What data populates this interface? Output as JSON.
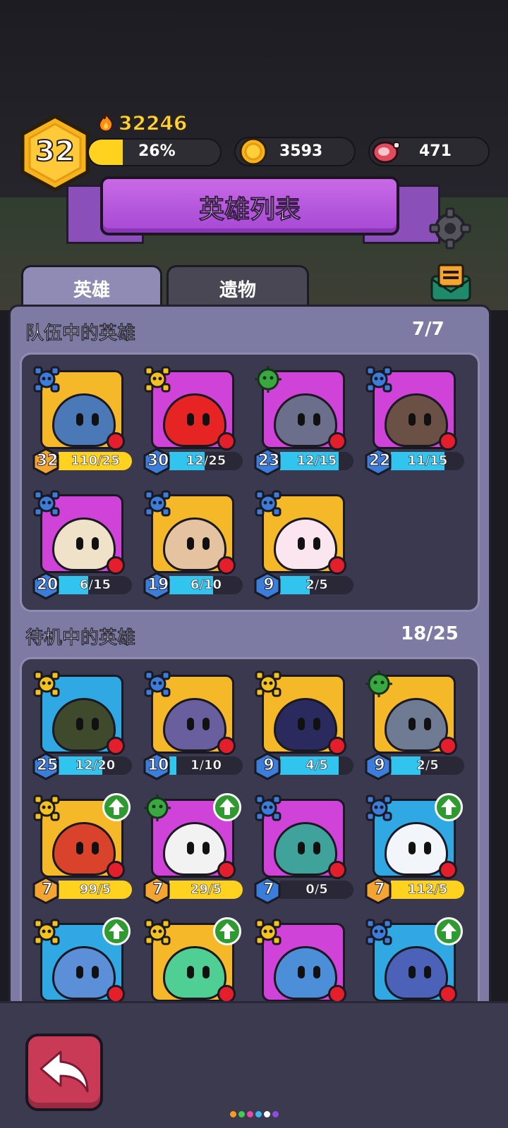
{
  "header": {
    "player_level": "32",
    "power": "32246",
    "xp_percent_label": "26%",
    "xp_fraction": 0.26,
    "gold": "3593",
    "meat": "471"
  },
  "title": "英雄列表",
  "tabs": [
    {
      "label": "英雄",
      "active": true
    },
    {
      "label": "遗物",
      "active": false
    }
  ],
  "team": {
    "title": "队伍中的英雄",
    "count": "7/7",
    "heroes": [
      {
        "level": "32",
        "progress": "110/25",
        "fill": 1.0,
        "bar_color": "#ffd21f",
        "class": "blue",
        "portrait_bg": "#f5b828",
        "body": "#4b79b8",
        "upgrade": false
      },
      {
        "level": "30",
        "progress": "12/25",
        "fill": 0.48,
        "bar_color": "#31c4ef",
        "class": "yellow",
        "portrait_bg": "#d043d8",
        "body": "#e72424",
        "upgrade": false
      },
      {
        "level": "23",
        "progress": "12/15",
        "fill": 0.8,
        "bar_color": "#31c4ef",
        "class": "green",
        "portrait_bg": "#d043d8",
        "body": "#6c6f8c",
        "upgrade": false
      },
      {
        "level": "22",
        "progress": "11/15",
        "fill": 0.73,
        "bar_color": "#31c4ef",
        "class": "blue",
        "portrait_bg": "#d043d8",
        "body": "#6b5145",
        "upgrade": false
      },
      {
        "level": "20",
        "progress": "6/15",
        "fill": 0.4,
        "bar_color": "#31c4ef",
        "class": "blue",
        "portrait_bg": "#d043d8",
        "body": "#efe2c8",
        "upgrade": false
      },
      {
        "level": "19",
        "progress": "6/10",
        "fill": 0.6,
        "bar_color": "#31c4ef",
        "class": "blue",
        "portrait_bg": "#f5b828",
        "body": "#e6c3a0",
        "upgrade": false
      },
      {
        "level": "9",
        "progress": "2/5",
        "fill": 0.4,
        "bar_color": "#31c4ef",
        "class": "blue",
        "portrait_bg": "#f5b828",
        "body": "#fbe5ef",
        "upgrade": false
      }
    ]
  },
  "idle": {
    "title": "待机中的英雄",
    "count": "18/25",
    "heroes": [
      {
        "level": "25",
        "progress": "12/20",
        "fill": 0.6,
        "bar_color": "#31c4ef",
        "class": "yellow",
        "portrait_bg": "#2fa8e3",
        "body": "#3f4a2c",
        "upgrade": false
      },
      {
        "level": "10",
        "progress": "1/10",
        "fill": 0.1,
        "bar_color": "#31c4ef",
        "class": "blue",
        "portrait_bg": "#f5b828",
        "body": "#6a5f9e",
        "upgrade": false
      },
      {
        "level": "9",
        "progress": "4/5",
        "fill": 0.8,
        "bar_color": "#31c4ef",
        "class": "yellow",
        "portrait_bg": "#f5b828",
        "body": "#2b2a5e",
        "upgrade": false
      },
      {
        "level": "9",
        "progress": "2/5",
        "fill": 0.4,
        "bar_color": "#31c4ef",
        "class": "green",
        "portrait_bg": "#f5b828",
        "body": "#6f7a93",
        "upgrade": false
      },
      {
        "level": "7",
        "progress": "99/5",
        "fill": 1.0,
        "bar_color": "#ffd21f",
        "class": "yellow",
        "portrait_bg": "#f5b828",
        "body": "#d9432b",
        "upgrade": true
      },
      {
        "level": "7",
        "progress": "29/5",
        "fill": 1.0,
        "bar_color": "#ffd21f",
        "class": "green",
        "portrait_bg": "#d043d8",
        "body": "#f2f2f2",
        "upgrade": true
      },
      {
        "level": "7",
        "progress": "0/5",
        "fill": 0.0,
        "bar_color": "#31c4ef",
        "class": "blue",
        "portrait_bg": "#d043d8",
        "body": "#3fa39b",
        "upgrade": false
      },
      {
        "level": "7",
        "progress": "112/5",
        "fill": 1.0,
        "bar_color": "#ffd21f",
        "class": "blue",
        "portrait_bg": "#2fa8e3",
        "body": "#f2f6fb",
        "upgrade": true
      },
      {
        "level": "",
        "progress": "",
        "fill": 0,
        "bar_color": "#31c4ef",
        "class": "yellow",
        "portrait_bg": "#2fa8e3",
        "body": "#5b8fd8",
        "upgrade": true
      },
      {
        "level": "",
        "progress": "",
        "fill": 0,
        "bar_color": "#31c4ef",
        "class": "yellow",
        "portrait_bg": "#f5b828",
        "body": "#4fcf93",
        "upgrade": true
      },
      {
        "level": "",
        "progress": "",
        "fill": 0,
        "bar_color": "#31c4ef",
        "class": "yellow",
        "portrait_bg": "#d043d8",
        "body": "#4c8fd8",
        "upgrade": false
      },
      {
        "level": "",
        "progress": "",
        "fill": 0,
        "bar_color": "#31c4ef",
        "class": "blue",
        "portrait_bg": "#2fa8e3",
        "body": "#4b62b8",
        "upgrade": true
      }
    ]
  },
  "page_dots": [
    "#ff9a1f",
    "#3ecf4e",
    "#e64aa8",
    "#3ab9ef",
    "#ffffff",
    "#8c4ee0"
  ]
}
